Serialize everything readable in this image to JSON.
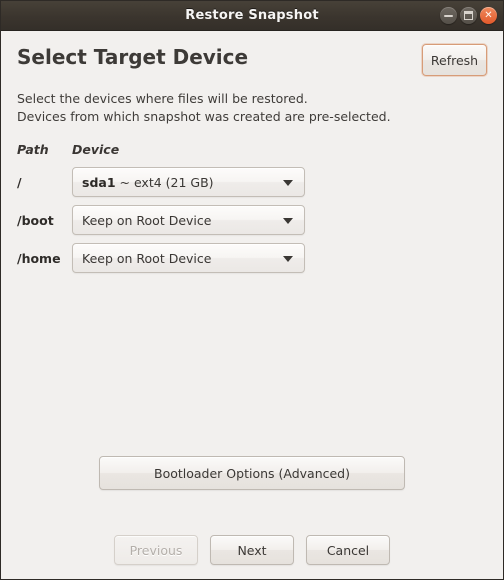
{
  "window": {
    "title": "Restore Snapshot",
    "controls": {
      "minimize_label": "minimize",
      "maximize_label": "maximize",
      "close_label": "close",
      "close_glyph": "✕"
    }
  },
  "header": {
    "title": "Select Target Device",
    "refresh_label": "Refresh"
  },
  "description": {
    "line1": "Select the devices where files will be restored.",
    "line2": "Devices from which snapshot was created are pre-selected."
  },
  "device_table": {
    "columns": {
      "path": "Path",
      "device": "Device"
    },
    "rows": [
      {
        "path": "/",
        "device_bold": "sda1",
        "device_rest": " ~ ext4 (21 GB)",
        "device_full": "sda1 ~ ext4 (21 GB)"
      },
      {
        "path": "/boot",
        "device_bold": "",
        "device_rest": "Keep on Root Device",
        "device_full": "Keep on Root Device"
      },
      {
        "path": "/home",
        "device_bold": "",
        "device_rest": "Keep on Root Device",
        "device_full": "Keep on Root Device"
      }
    ]
  },
  "bootloader": {
    "label": "Bootloader Options (Advanced)"
  },
  "actions": {
    "previous_label": "Previous",
    "previous_enabled": false,
    "next_label": "Next",
    "cancel_label": "Cancel"
  },
  "colors": {
    "titlebar": "#3b352e",
    "window_bg": "#f2f0ee",
    "close_button": "#e2592a",
    "refresh_focus_border": "#d79c78",
    "text": "#3d3a37"
  }
}
